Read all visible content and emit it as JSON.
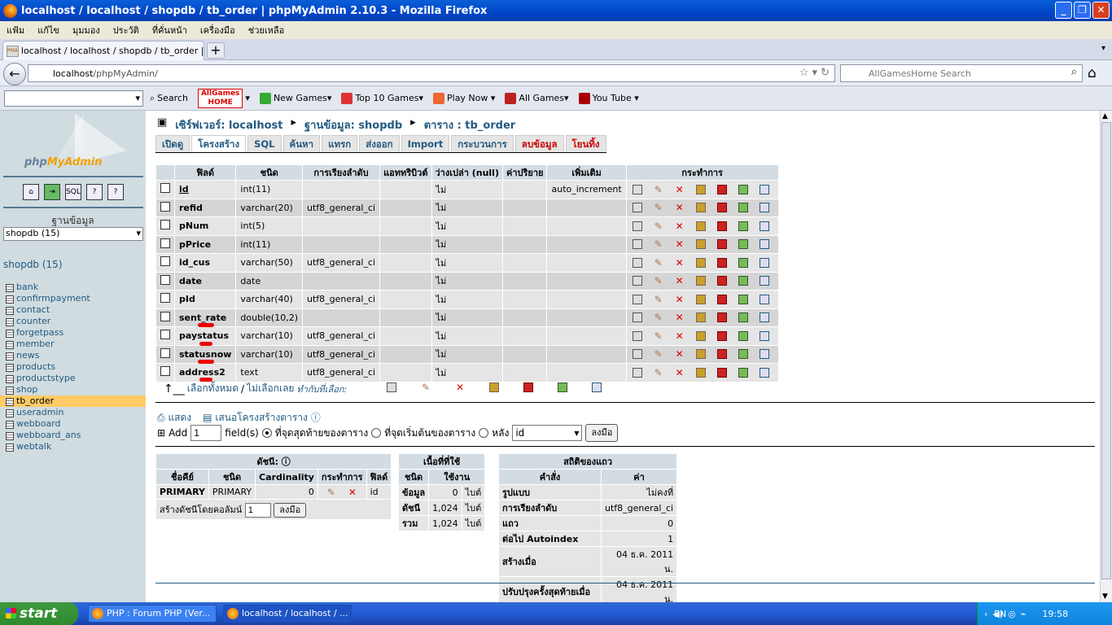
{
  "window": {
    "title": "localhost / localhost / shopdb / tb_order | phpMyAdmin 2.10.3 - Mozilla Firefox"
  },
  "menubar": [
    "แฟ้ม",
    "แก้ไข",
    "มุมมอง",
    "ประวัติ",
    "ที่คั่นหน้า",
    "เครื่องมือ",
    "ช่วยเหลือ"
  ],
  "tab": {
    "label": "localhost / localhost / shopdb / tb_order | ph...",
    "favicon": "PMA"
  },
  "url": {
    "host": "localhost",
    "path": "/phpMyAdmin/"
  },
  "search": {
    "placeholder": "AllGamesHome Search"
  },
  "toolbar": {
    "search": "Search",
    "brand_top": "AllGames",
    "brand_bottom": "HOME",
    "items": [
      "New Games▾",
      "Top 10 Games▾",
      "Play Now ▾",
      "All Games▾",
      "You Tube ▾"
    ]
  },
  "left": {
    "logo": "php",
    "logo2": "MyAdmin",
    "db_label": "ฐานข้อมูล",
    "db_select": "shopdb (15)",
    "db_name": "shopdb (15)",
    "tables": [
      "bank",
      "confirmpayment",
      "contact",
      "counter",
      "forgetpass",
      "member",
      "news",
      "products",
      "productstype",
      "shop",
      "tb_order",
      "useradmin",
      "webboard",
      "webboard_ans",
      "webtalk"
    ],
    "active_table": "tb_order"
  },
  "breadcrumb": {
    "server": "เซิร์ฟเวอร์: localhost",
    "db": "ฐานข้อมูล: shopdb",
    "table": "ตาราง : tb_order"
  },
  "tabs": [
    "เปิดดู",
    "โครงสร้าง",
    "SQL",
    "ค้นหา",
    "แทรก",
    "ส่งออก",
    "Import",
    "กระบวนการ",
    "ลบข้อมูล",
    "โยนทิ้ง"
  ],
  "structure": {
    "headers": [
      "ฟิลด์",
      "ชนิด",
      "การเรียงลำดับ",
      "แอททริบิวต์",
      "ว่างเปล่า (null)",
      "ค่าปริยาย",
      "เพิ่มเติม",
      "กระทำการ"
    ],
    "rows": [
      {
        "field": "id",
        "type": "int(11)",
        "collation": "",
        "attr": "",
        "null": "ไม่",
        "default": "",
        "extra": "auto_increment"
      },
      {
        "field": "refid",
        "type": "varchar(20)",
        "collation": "utf8_general_ci",
        "attr": "",
        "null": "ไม่",
        "default": "",
        "extra": ""
      },
      {
        "field": "pNum",
        "type": "int(5)",
        "collation": "",
        "attr": "",
        "null": "ไม่",
        "default": "",
        "extra": ""
      },
      {
        "field": "pPrice",
        "type": "int(11)",
        "collation": "",
        "attr": "",
        "null": "ไม่",
        "default": "",
        "extra": ""
      },
      {
        "field": "id_cus",
        "type": "varchar(50)",
        "collation": "utf8_general_ci",
        "attr": "",
        "null": "ไม่",
        "default": "",
        "extra": ""
      },
      {
        "field": "date",
        "type": "date",
        "collation": "",
        "attr": "",
        "null": "ไม่",
        "default": "",
        "extra": ""
      },
      {
        "field": "pId",
        "type": "varchar(40)",
        "collation": "utf8_general_ci",
        "attr": "",
        "null": "ไม่",
        "default": "",
        "extra": ""
      },
      {
        "field": "sent_rate",
        "type": "double(10,2)",
        "collation": "",
        "attr": "",
        "null": "ไม่",
        "default": "",
        "extra": ""
      },
      {
        "field": "paystatus",
        "type": "varchar(10)",
        "collation": "utf8_general_ci",
        "attr": "",
        "null": "ไม่",
        "default": "",
        "extra": ""
      },
      {
        "field": "statusnow",
        "type": "varchar(10)",
        "collation": "utf8_general_ci",
        "attr": "",
        "null": "ไม่",
        "default": "",
        "extra": ""
      },
      {
        "field": "address2",
        "type": "text",
        "collation": "utf8_general_ci",
        "attr": "",
        "null": "ไม่",
        "default": "",
        "extra": ""
      }
    ],
    "check_all": "เลือกทั้งหมด",
    "uncheck_all": "ไม่เลือกเลย",
    "with_selected": "ทำกับที่เลือก:"
  },
  "print": {
    "print_view": "แสดง",
    "propose": "เสนอโครงสร้างตาราง"
  },
  "add": {
    "label": "Add",
    "count": "1",
    "fields": "field(s)",
    "at_end": "ที่จุดสุดท้ายของตาราง",
    "at_begin": "ที่จุดเริ่มต้นของตาราง",
    "after": "หลัง",
    "after_field": "id",
    "go": "ลงมือ"
  },
  "indexes": {
    "title": "ดัชนี:",
    "headers": [
      "ชื่อคีย์",
      "ชนิด",
      "Cardinality",
      "กระทำการ",
      "ฟิลด์"
    ],
    "row": {
      "name": "PRIMARY",
      "type": "PRIMARY",
      "card": "0",
      "field": "id"
    },
    "create_label": "สร้างดัชนีโดยคอลัมน์",
    "create_count": "1",
    "go": "ลงมือ"
  },
  "space": {
    "title": "เนื้อที่ที่ใช้",
    "headers": [
      "ชนิด",
      "ใช้งาน"
    ],
    "rows": [
      {
        "type": "ข้อมูล",
        "val": "0",
        "unit": "ไบต์"
      },
      {
        "type": "ดัชนี",
        "val": "1,024",
        "unit": "ไบต์"
      },
      {
        "type": "รวม",
        "val": "1,024",
        "unit": "ไบต์"
      }
    ]
  },
  "rowstats": {
    "title": "สถิติของแถว",
    "headers": [
      "คำสั่ง",
      "ค่า"
    ],
    "rows": [
      {
        "k": "รูปแบบ",
        "v": "ไม่คงที่"
      },
      {
        "k": "การเรียงลำดับ",
        "v": "utf8_general_ci"
      },
      {
        "k": "แถว",
        "v": "0"
      },
      {
        "k": "ต่อไป Autoindex",
        "v": "1"
      },
      {
        "k": "สร้างเมื่อ",
        "v": "04 ธ.ค. 2011 น."
      },
      {
        "k": "ปรับปรุงครั้งสุดท้ายเมื่อ",
        "v": "04 ธ.ค. 2011 น."
      }
    ]
  },
  "taskbar": {
    "start": "start",
    "tasks": [
      "PHP : Forum PHP (Ver...",
      "localhost / localhost / ..."
    ],
    "lang": "EN",
    "time": "19:58"
  }
}
